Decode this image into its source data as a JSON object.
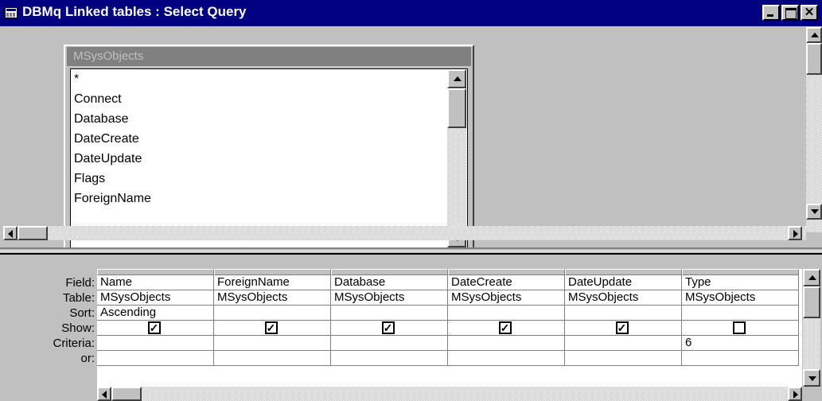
{
  "window": {
    "title": "DBMq Linked tables : Select Query",
    "close_glyph": "✕"
  },
  "field_list": {
    "table_name": "MSysObjects",
    "items": [
      "*",
      "Connect",
      "Database",
      "DateCreate",
      "DateUpdate",
      "Flags",
      "ForeignName"
    ]
  },
  "grid": {
    "row_labels": {
      "field": "Field:",
      "table": "Table:",
      "sort": "Sort:",
      "show": "Show:",
      "criteria": "Criteria:",
      "or": "or:"
    },
    "columns": [
      {
        "field": "Name",
        "table": "MSysObjects",
        "sort": "Ascending",
        "show": true,
        "criteria": ""
      },
      {
        "field": "ForeignName",
        "table": "MSysObjects",
        "sort": "",
        "show": true,
        "criteria": ""
      },
      {
        "field": "Database",
        "table": "MSysObjects",
        "sort": "",
        "show": true,
        "criteria": ""
      },
      {
        "field": "DateCreate",
        "table": "MSysObjects",
        "sort": "",
        "show": true,
        "criteria": ""
      },
      {
        "field": "DateUpdate",
        "table": "MSysObjects",
        "sort": "",
        "show": true,
        "criteria": ""
      },
      {
        "field": "Type",
        "table": "MSysObjects",
        "sort": "",
        "show": false,
        "criteria": "6"
      }
    ],
    "checked_glyph": "✓"
  },
  "colors": {
    "titlebar": "#000080",
    "window_face": "#c0c0c0",
    "inactive_caption": "#808080"
  }
}
